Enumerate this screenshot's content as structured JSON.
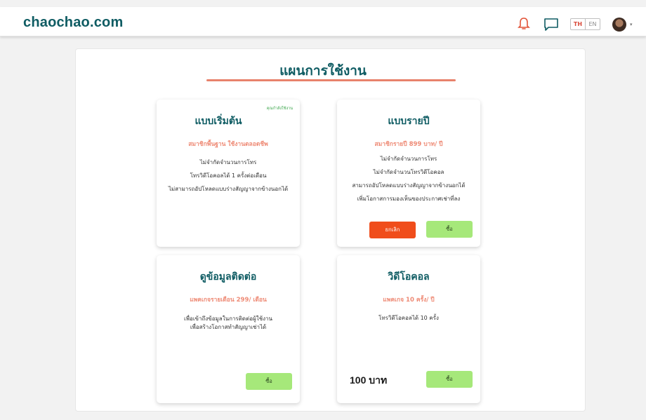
{
  "header": {
    "brand": "chaochao.com",
    "lang_th": "TH",
    "lang_en": "EN",
    "caret": "▾",
    "accent_color": "#0f5c63"
  },
  "main": {
    "title": "แผนการใช้งาน"
  },
  "plans": [
    {
      "title": "แบบเริ่มต้น",
      "status": "คุณกำลังใช้งาน",
      "subtitle": "สมาชิกพื้นฐาน ใช้งานตลอดชีพ",
      "features": [
        "ไม่จำกัดจำนวนการโทร",
        "โทรวิดีโอคอลได้ 1 ครั้งต่อเดือน",
        "ไม่สามารถอัปโหลดแบบร่างสัญญาจากข้างนอกได้"
      ]
    },
    {
      "title": "แบบรายปี",
      "subtitle": "สมาชิกรายปี 899 บาท/ ปี",
      "features": [
        "ไม่จำกัดจำนวนการโทร",
        "ไม่จำกัดจำนวนโทรวิดีโอคอล",
        "สามารถอัปโหลดแบบร่างสัญญาจากข้างนอกได้",
        "เพิ่มโอกาสการมองเห็นของประกาศเช่าที่ลง"
      ],
      "cancel_label": "ยกเลิก",
      "buy_label": "ซื้อ"
    },
    {
      "title": "ดูข้อมูลติดต่อ",
      "subtitle": "แพคเกจรายเดือน 299/ เดือน",
      "features": [
        "เพื่อเข้าถึงข้อมูลในการติดต่อผู้ใช้งาน",
        "เพื่อสร้างโอกาสทำสัญญาเช่าได้"
      ],
      "buy_label": "ซื้อ"
    },
    {
      "title": "วิดีโอคอล",
      "subtitle": "แพคเกจ 10 ครั้ง/ ปี",
      "features": [
        "โทรวิดีโอคอลได้ 10 ครั้ง"
      ],
      "price": "100 บาท",
      "buy_label": "ซื้อ"
    }
  ]
}
